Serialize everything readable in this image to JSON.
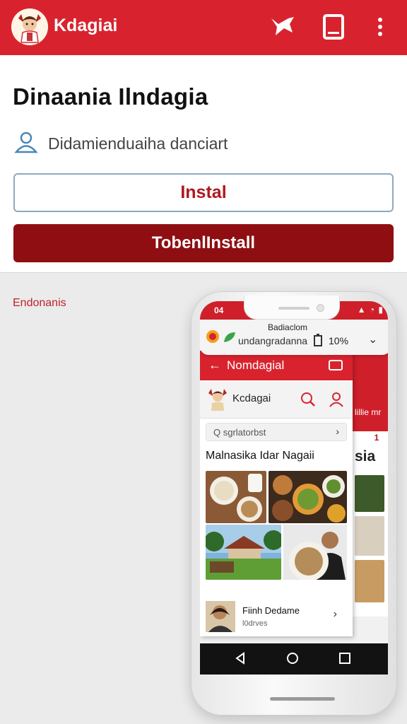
{
  "app_bar": {
    "title": "Kdagiai",
    "icons": [
      "logo-mascot",
      "share-icon",
      "tablet-icon",
      "more-vert-icon"
    ],
    "color": "#d8232e"
  },
  "listing": {
    "title": "Dinaania Ilndagia",
    "developer": "Didamienduaiha danciart",
    "install_label": "Instal",
    "primary_button_label": "TobenlInstall",
    "accent_color": "#8f0e11"
  },
  "section_label": "Endonanis",
  "phone": {
    "status_time": "04",
    "notification": {
      "title": "Badiaclom",
      "text": "undangradanna",
      "percent": "10%"
    },
    "back_app": {
      "label": "lillie mr",
      "badge": "1",
      "heading": "sia"
    },
    "front_app": {
      "header_title": "Nomdagial",
      "app_name": "Kcdagai",
      "search_placeholder": "Q sgrlatorbst",
      "heading": "Malnasika Idar Nagaii",
      "row_title": "Fiinh Dedame",
      "row_subtitle": "l0drves"
    }
  }
}
